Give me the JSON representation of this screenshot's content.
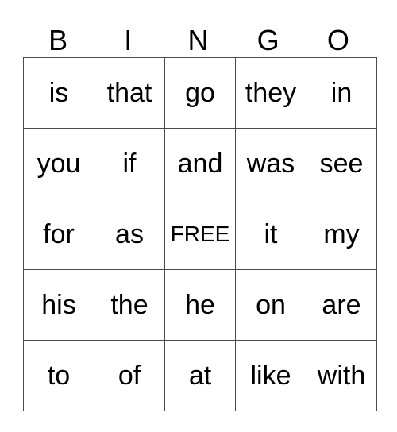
{
  "card": {
    "header": [
      "B",
      "I",
      "N",
      "G",
      "O"
    ],
    "rows": [
      [
        "is",
        "that",
        "go",
        "they",
        "in"
      ],
      [
        "you",
        "if",
        "and",
        "was",
        "see"
      ],
      [
        "for",
        "as",
        "FREE",
        "it",
        "my"
      ],
      [
        "his",
        "the",
        "he",
        "on",
        "are"
      ],
      [
        "to",
        "of",
        "at",
        "like",
        "with"
      ]
    ],
    "free_label": "FREE"
  }
}
